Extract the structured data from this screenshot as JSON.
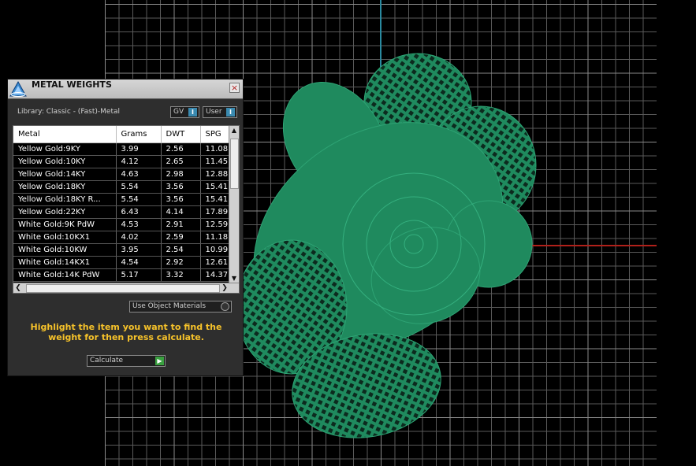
{
  "window": {
    "title": "METAL WEIGHTS",
    "close_glyph": "×",
    "logo_icon": "rhino-gold-logo-icon"
  },
  "library": {
    "label": "Library: Classic - (Fast)-Metal",
    "gv_label": "GV",
    "user_label": "User",
    "toggle_glyph": "I"
  },
  "table": {
    "columns": [
      "Metal",
      "Grams",
      "DWT",
      "SPG"
    ],
    "rows": [
      [
        "Yellow Gold:9KY",
        "3.99",
        "2.56",
        "11.08"
      ],
      [
        "Yellow Gold:10KY",
        "4.12",
        "2.65",
        "11.45"
      ],
      [
        "Yellow Gold:14KY",
        "4.63",
        "2.98",
        "12.88"
      ],
      [
        "Yellow Gold:18KY",
        "5.54",
        "3.56",
        "15.41"
      ],
      [
        "Yellow Gold:18KY R...",
        "5.54",
        "3.56",
        "15.41"
      ],
      [
        "Yellow Gold:22KY",
        "6.43",
        "4.14",
        "17.89"
      ],
      [
        "White Gold:9K PdW",
        "4.53",
        "2.91",
        "12.59"
      ],
      [
        "White Gold:10KX1",
        "4.02",
        "2.59",
        "11.18"
      ],
      [
        "White Gold:10KW",
        "3.95",
        "2.54",
        "10.99"
      ],
      [
        "White Gold:14KX1",
        "4.54",
        "2.92",
        "12.61"
      ],
      [
        "White Gold:14K PdW",
        "5.17",
        "3.32",
        "14.37"
      ]
    ],
    "scroll_up": "▲",
    "scroll_down": "▼",
    "scroll_left": "❮",
    "scroll_right": "❯"
  },
  "options": {
    "use_object_materials": "Use Object Materials"
  },
  "instructions": "Highlight the item you want to find the weight for then press calculate.",
  "calculate": {
    "label": "Calculate",
    "go_glyph": "▶"
  },
  "colors": {
    "model_green": "#1f8a5e",
    "axis_y": "#2a8aa0",
    "axis_x": "#b0201a",
    "instruction_text": "#f6c22a"
  }
}
